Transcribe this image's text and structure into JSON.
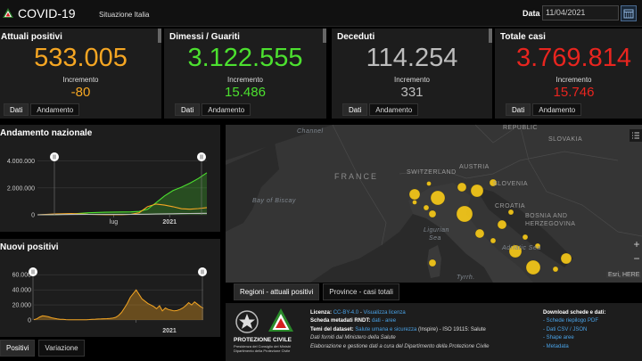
{
  "header": {
    "title": "COVID-19",
    "subtitle": "Situazione Italia",
    "date_label": "Data",
    "date_value": "11/04/2021"
  },
  "kpis": [
    {
      "title": "Attuali positivi",
      "value": "533.005",
      "increment_label": "Incremento",
      "increment": "-80",
      "color": "#f5a623",
      "tabs": [
        "Dati",
        "Andamento"
      ]
    },
    {
      "title": "Dimessi / Guariti",
      "value": "3.122.555",
      "increment_label": "Incremento",
      "increment": "15.486",
      "color": "#4ce02f",
      "tabs": [
        "Dati",
        "Andamento"
      ]
    },
    {
      "title": "Deceduti",
      "value": "114.254",
      "increment_label": "Incremento",
      "increment": "331",
      "color": "#bdbdbd",
      "tabs": [
        "Dati",
        "Andamento"
      ]
    },
    {
      "title": "Totale casi",
      "value": "3.769.814",
      "increment_label": "Incremento",
      "increment": "15.746",
      "color": "#e8251f",
      "tabs": [
        "Dati",
        "Andamento"
      ]
    }
  ],
  "andamento_panel": {
    "title": "Andamento nazionale"
  },
  "nuovi_panel": {
    "title": "Nuovi positivi"
  },
  "bottom_tabs": [
    "Positivi",
    "Variazione"
  ],
  "map": {
    "labels": {
      "france": "FRANCE",
      "switzerland": "SWITZERLAND",
      "austria": "AUSTRIA",
      "slovenia": "SLOVENIA",
      "croatia": "CROATIA",
      "bosnia": "BOSNIA AND",
      "herzegovina": "HERZEGOVINA",
      "slovakia": "SLOVAKIA",
      "republic": "REPUBLIC",
      "channel": "Channel",
      "biscay1": "Bay of Biscay",
      "ligurian1": "Ligurian",
      "ligurian2": "Sea",
      "adriatic": "Adriatic Sea",
      "tyrrh": "Tyrrh."
    },
    "attribution": "Esri, HERE",
    "tabs": [
      "Regioni - attuali positivi",
      "Province - casi totali"
    ]
  },
  "footer": {
    "pc_name": "PROTEZIONE CIVILE",
    "pc_sub1": "Presidenza del Consiglio dei Ministri",
    "pc_sub2": "Dipartimento della Protezione Civile",
    "licenza_label": "Licenza:",
    "licenza_link": "CC-BY-4.0",
    "licenza_view": "Visualizza licenza",
    "scheda_label": "Scheda metadati RNDT:",
    "scheda_links": "dati - aree",
    "temi_label": "Temi del dataset:",
    "temi_link": "Salute umana e sicurezza",
    "temi_rest": "(Inspire) - ISO 19115: Salute",
    "fonte": "Dati forniti dal Ministero della Salute",
    "gestione": "Elaborazione e gestione dati a cura del Dipartimento della Protezione Civile",
    "download_title": "Download schede e dati:",
    "download_links": [
      "- Schede riepilogo PDF",
      "- Dati CSV / JSON",
      "- Shape aree",
      "- Metadata"
    ]
  },
  "chart_data": [
    {
      "type": "area",
      "title": "Andamento nazionale",
      "x_ticks": [
        "lug",
        "2021"
      ],
      "y_ticks": [
        "4.000.000",
        "2.000.000",
        "0"
      ],
      "ylim": [
        0,
        4500000
      ],
      "x": [
        0,
        0.1,
        0.2,
        0.3,
        0.4,
        0.5,
        0.55,
        0.6,
        0.65,
        0.7,
        0.75,
        0.8,
        0.85,
        0.9,
        0.95,
        1.0
      ],
      "series": [
        {
          "name": "Dimessi / Guariti",
          "color": "#4ce02f",
          "values": [
            0,
            10000,
            60000,
            150000,
            190000,
            210000,
            220000,
            250000,
            420000,
            900000,
            1400000,
            1800000,
            2050000,
            2350000,
            2700000,
            3122555
          ]
        },
        {
          "name": "Attuali positivi",
          "color": "#f5a623",
          "values": [
            0,
            60000,
            100000,
            40000,
            15000,
            14000,
            30000,
            150000,
            600000,
            800000,
            720000,
            600000,
            450000,
            420000,
            460000,
            533005
          ]
        },
        {
          "name": "Deceduti",
          "color": "#bdbdbd",
          "values": [
            0,
            10000,
            25000,
            34000,
            35000,
            35500,
            36000,
            37000,
            45000,
            60000,
            70000,
            80000,
            90000,
            98000,
            106000,
            114254
          ]
        }
      ]
    },
    {
      "type": "area",
      "title": "Nuovi positivi",
      "x_ticks": [
        "2021"
      ],
      "y_ticks": [
        "60.000",
        "40.000",
        "20.000",
        "0"
      ],
      "ylim": [
        0,
        65000
      ],
      "series": [
        {
          "name": "Nuovi positivi",
          "color": "#f5a623",
          "values": [
            500,
            1500,
            4000,
            5500,
            5000,
            4200,
            3000,
            2200,
            1500,
            1000,
            800,
            500,
            400,
            300,
            250,
            200,
            250,
            300,
            400,
            600,
            900,
            1100,
            1300,
            1400,
            1600,
            1800,
            2000,
            2500,
            3500,
            6000,
            10000,
            16000,
            22000,
            30000,
            35000,
            40000,
            34000,
            28000,
            25000,
            22000,
            20000,
            18000,
            15000,
            19000,
            12000,
            16000,
            14000,
            13000,
            12000,
            12500,
            14000,
            16000,
            19000,
            23000,
            20000,
            24000,
            21000,
            18000,
            15700
          ]
        }
      ]
    }
  ]
}
